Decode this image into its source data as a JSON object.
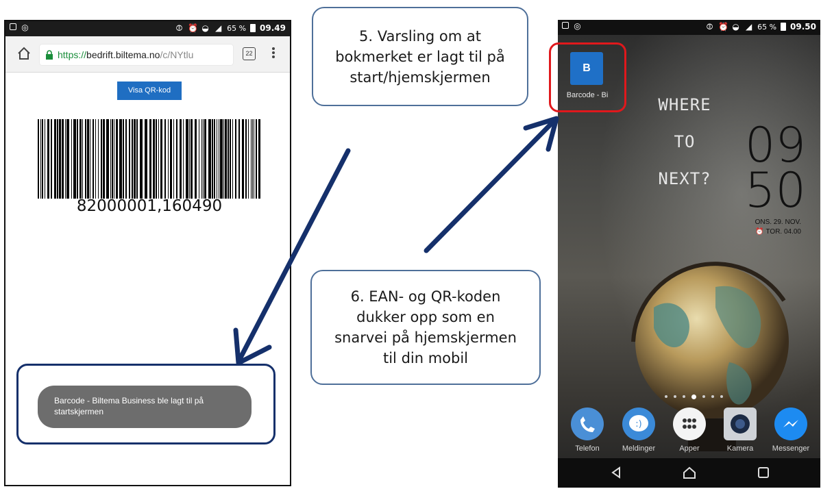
{
  "left_phone": {
    "status": {
      "battery_pct": "65 %",
      "time": "09.49"
    },
    "browser": {
      "url_scheme": "https://",
      "url_host": "bedrift.biltema.no",
      "url_path": "/c/NYtlu",
      "tab_count": "22"
    },
    "qr_button_label": "Visa QR-kod",
    "barcode_number": "82000001,160490",
    "toast_text": "Barcode - Biltema Business ble lagt til på startskjermen"
  },
  "callouts": {
    "step5_lines": [
      "5. Varsling om at",
      "bokmerket er lagt til på",
      "start/hjemskjermen"
    ],
    "step6_lines": [
      "6. EAN- og QR-koden",
      "dukker opp som en",
      "snarvei på hjemskjermen",
      "til din mobil"
    ]
  },
  "right_phone": {
    "status": {
      "battery_pct": "65 %",
      "time": "09.50"
    },
    "app_shortcut": {
      "letter": "B",
      "label": "Barcode - Bi"
    },
    "wallpaper_text": [
      "WHERE TO",
      "NEXT?"
    ],
    "clock": {
      "hour": "09",
      "minute": "50",
      "date": "ONS. 29. NOV.",
      "alarm": "TOR. 04.00"
    },
    "dock": [
      "Telefon",
      "Meldinger",
      "Apper",
      "Kamera",
      "Messenger"
    ],
    "colors": {
      "shortcut_blue": "#1f70c7",
      "highlight_red": "#e0181c",
      "arrow_navy": "#15306b"
    }
  }
}
